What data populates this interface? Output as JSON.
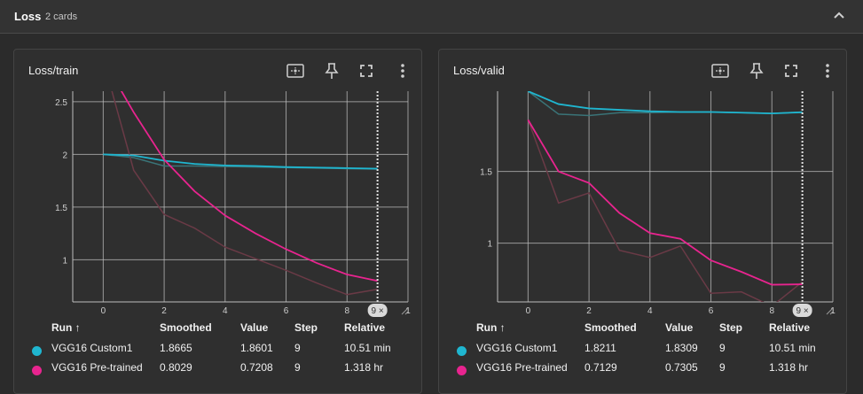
{
  "section": {
    "title": "Loss",
    "count": "2 cards"
  },
  "legend_headers": {
    "run": "Run",
    "sort_arrow": "↑",
    "smoothed": "Smoothed",
    "value": "Value",
    "step": "Step",
    "relative": "Relative"
  },
  "colors": {
    "custom": "#1fb6d0",
    "pretrained": "#e8248f",
    "custom_raw": "#3a7478",
    "pretrained_raw": "#6a3a46"
  },
  "cards": [
    {
      "title": "Loss/train",
      "step_badge": "9 ×",
      "runs": [
        {
          "name": "VGG16 Custom1",
          "smoothed": "1.8665",
          "value": "1.8601",
          "step": "9",
          "relative": "10.51 min"
        },
        {
          "name": "VGG16 Pre-trained",
          "smoothed": "0.8029",
          "value": "0.7208",
          "step": "9",
          "relative": "1.318 hr"
        }
      ]
    },
    {
      "title": "Loss/valid",
      "step_badge": "9 ×",
      "runs": [
        {
          "name": "VGG16 Custom1",
          "smoothed": "1.8211",
          "value": "1.8309",
          "step": "9",
          "relative": "10.51 min"
        },
        {
          "name": "VGG16 Pre-trained",
          "smoothed": "0.7129",
          "value": "0.7305",
          "step": "9",
          "relative": "1.318 hr"
        }
      ]
    }
  ],
  "chart_data": [
    {
      "type": "line",
      "title": "Loss/train",
      "xlim": [
        -1,
        10
      ],
      "ylim": [
        0.6,
        2.6
      ],
      "x_ticks": [
        "0",
        "2",
        "4",
        "6",
        "8",
        "1"
      ],
      "y_ticks": [
        "1",
        "1.5",
        "2",
        "2.5"
      ],
      "y_tick_values": [
        1,
        1.5,
        2,
        2.5
      ],
      "x": [
        0,
        1,
        2,
        3,
        4,
        5,
        6,
        7,
        8,
        9
      ],
      "series": [
        {
          "name": "VGG16 Custom1",
          "smoothed": [
            2.0,
            1.99,
            1.94,
            1.91,
            1.895,
            1.89,
            1.88,
            1.875,
            1.87,
            1.865
          ],
          "raw": [
            2.0,
            1.97,
            1.89,
            1.89,
            1.885,
            1.88,
            1.875,
            1.87,
            1.865,
            1.86
          ]
        },
        {
          "name": "VGG16 Pre-trained",
          "smoothed": [
            2.9,
            2.4,
            1.95,
            1.65,
            1.42,
            1.25,
            1.1,
            0.97,
            0.86,
            0.8
          ],
          "raw": [
            2.9,
            1.85,
            1.43,
            1.3,
            1.12,
            1.01,
            0.9,
            0.78,
            0.67,
            0.72
          ]
        }
      ]
    },
    {
      "type": "line",
      "title": "Loss/valid",
      "xlim": [
        -1,
        10
      ],
      "ylim": [
        0.59,
        2.06
      ],
      "x_ticks": [
        "0",
        "2",
        "4",
        "6",
        "8",
        "1"
      ],
      "y_ticks": [
        "1",
        "1.5"
      ],
      "y_tick_values": [
        1,
        1.5
      ],
      "x": [
        0,
        1,
        2,
        3,
        4,
        5,
        6,
        7,
        8,
        9
      ],
      "series": [
        {
          "name": "VGG16 Custom1",
          "smoothed": [
            2.06,
            1.97,
            1.94,
            1.93,
            1.92,
            1.915,
            1.915,
            1.91,
            1.905,
            1.913
          ],
          "raw": [
            2.06,
            1.9,
            1.89,
            1.91,
            1.91,
            1.915,
            1.915,
            1.91,
            1.905,
            1.915
          ]
        },
        {
          "name": "VGG16 Pre-trained",
          "smoothed": [
            1.86,
            1.5,
            1.42,
            1.21,
            1.07,
            1.03,
            0.88,
            0.8,
            0.71,
            0.713
          ],
          "raw": [
            1.86,
            1.28,
            1.35,
            0.95,
            0.9,
            0.98,
            0.65,
            0.66,
            0.56,
            0.73
          ]
        }
      ]
    }
  ]
}
